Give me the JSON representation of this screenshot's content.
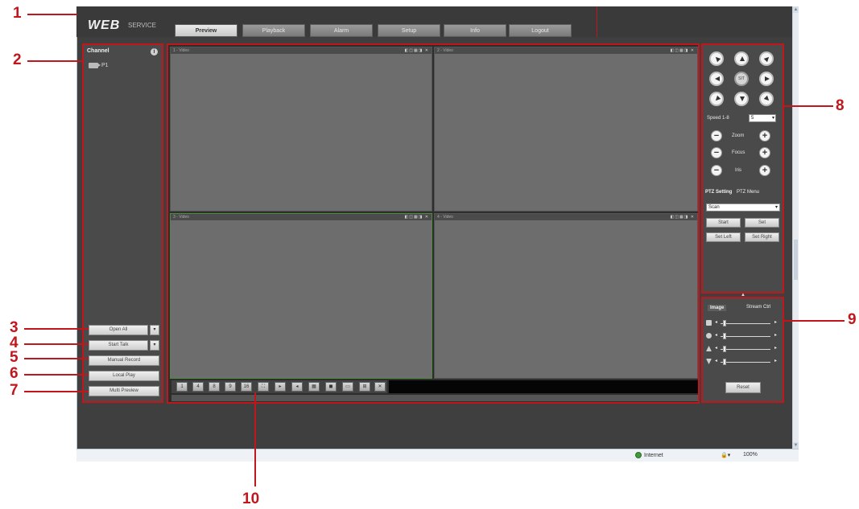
{
  "callouts": [
    "1",
    "2",
    "3",
    "4",
    "5",
    "6",
    "7",
    "8",
    "9",
    "10"
  ],
  "header": {
    "logo_main": "WEB",
    "logo_sub": "SERVICE",
    "tabs": [
      "Preview",
      "Playback",
      "Alarm",
      "Setup",
      "Info",
      "Logout"
    ]
  },
  "channel_panel": {
    "title": "Channel",
    "info_glyph": "i",
    "channel_label": "P1",
    "buttons": {
      "open_all": "Open All",
      "refresh": "Start Talk",
      "manual_record": "Manual Record",
      "local_play": "Local Play",
      "multi_preview": "Multi Preview"
    },
    "drop_glyph": "▾"
  },
  "video": {
    "window_labels": [
      "1 - Video",
      "2 - Video",
      "3 - Video",
      "4 - Video"
    ],
    "window_icons": "◧◫▦◨ ✕",
    "toolbar_buttons": [
      "1",
      "4",
      "8",
      "9",
      "16",
      "⛶",
      "▸",
      "◂",
      "▦",
      "◼",
      "▭",
      "⊞",
      "✕"
    ]
  },
  "ptz": {
    "center_label": "SIT",
    "speed_label": "Speed 1-8",
    "speed_value": "5",
    "zoom_label": "Zoom",
    "focus_label": "Focus",
    "iris_label": "Iris",
    "minus": "−",
    "plus": "+",
    "tab_setting": "PTZ Setting",
    "tab_menu": "PTZ Menu",
    "mode_value": "Scan",
    "btn_start": "Start",
    "btn_set": "Set",
    "btn_set_left": "Set Left",
    "btn_set_right": "Set Right"
  },
  "image_panel": {
    "toggle": "▲",
    "tab_image": "Image",
    "tab_stream": "Stream Ctrl",
    "left_arrow": "◂",
    "right_arrow": "▸",
    "reset_label": "Reset"
  },
  "statusbar": {
    "zone": "Internet",
    "protected": "🔒▾",
    "zoom": "100%"
  }
}
